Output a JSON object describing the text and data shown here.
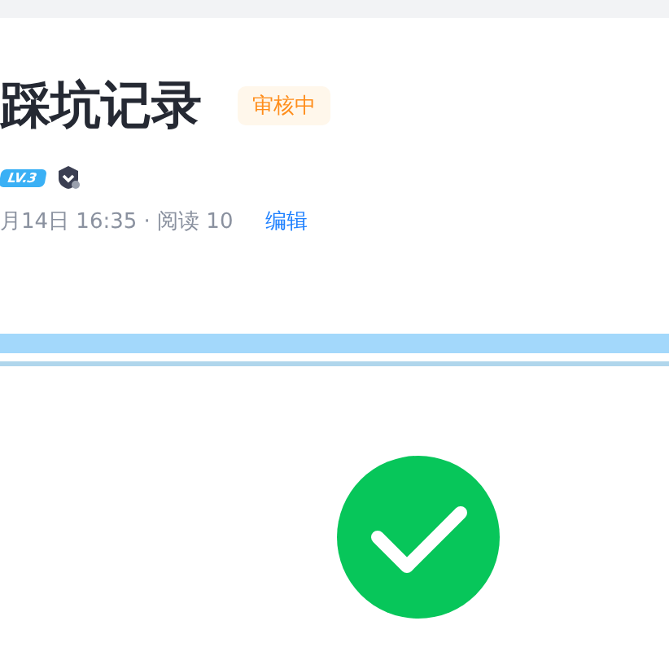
{
  "article": {
    "title": "踩坑记录",
    "status_badge": "审核中",
    "author_level": "LV.3",
    "meta": "月14日 16:35 · 阅读 10",
    "edit_link": "编辑"
  }
}
